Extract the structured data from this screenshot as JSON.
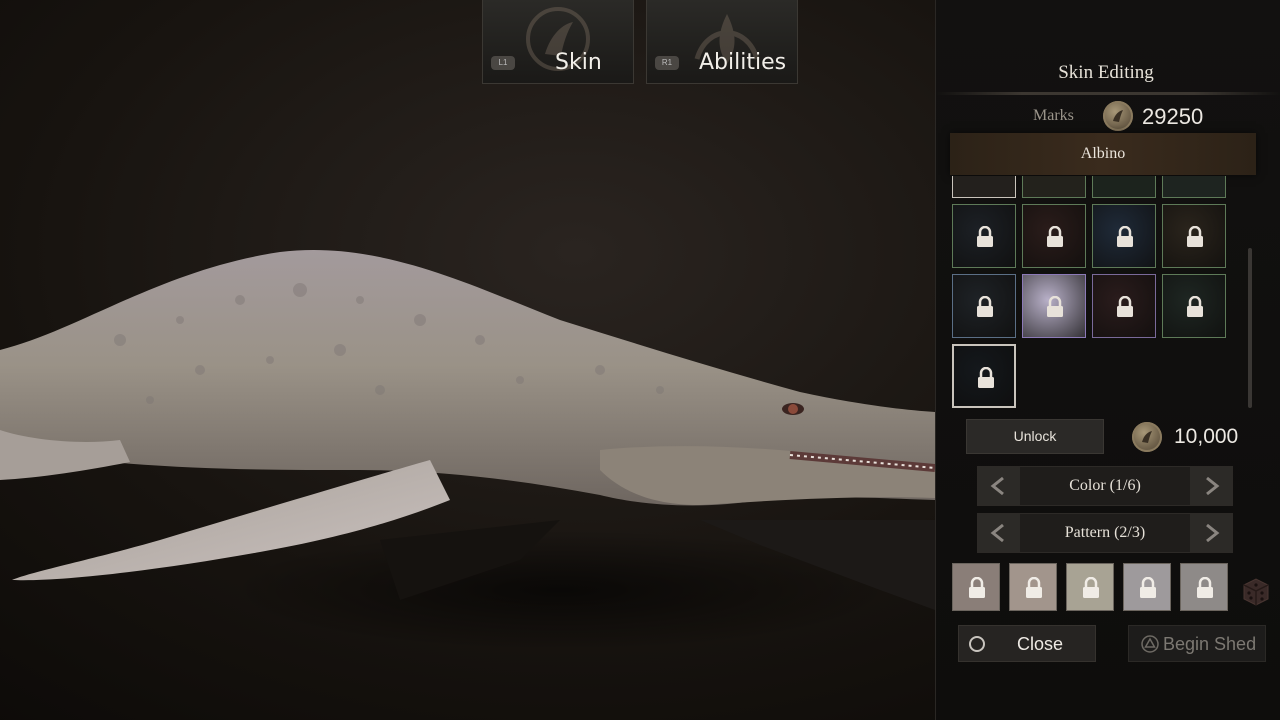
{
  "tabs": {
    "skin": {
      "label": "Skin",
      "button_hint": "L1"
    },
    "abilities": {
      "label": "Abilities",
      "button_hint": "R1"
    }
  },
  "panel": {
    "title": "Skin Editing",
    "marks_label": "Marks",
    "marks_value": "29250",
    "selected_skin": "Albino",
    "skin_tiles": [
      {
        "state": "locked",
        "border": "#5e7a58",
        "fill": "#1c2025"
      },
      {
        "state": "locked",
        "border": "#5e7a58",
        "fill": "#2a1c1a"
      },
      {
        "state": "locked",
        "border": "#5e7a58",
        "fill": "#1f2a38"
      },
      {
        "state": "locked",
        "border": "#5e7a58",
        "fill": "#2a241c"
      },
      {
        "state": "locked",
        "border": "#5b6f86",
        "fill": "#1e2226"
      },
      {
        "state": "selected-locked",
        "border": "#8c7ab8",
        "fill": "#b8b0c8"
      },
      {
        "state": "locked",
        "border": "#7a6a9a",
        "fill": "#2a1c1c"
      },
      {
        "state": "locked",
        "border": "#5e7a58",
        "fill": "#1e2622"
      },
      {
        "state": "locked",
        "border": "#c9c4bc",
        "fill": "#14181c"
      }
    ],
    "unlock_label": "Unlock",
    "unlock_cost": "10,000",
    "color_selector": "Color (1/6)",
    "pattern_selector": "Pattern (2/3)",
    "color_swatches": [
      {
        "color": "#8a7e78",
        "state": "locked"
      },
      {
        "color": "#a2958c",
        "state": "locked"
      },
      {
        "color": "#a8a394",
        "state": "locked"
      },
      {
        "color": "#9e9a9c",
        "state": "locked"
      },
      {
        "color": "#8e8a88",
        "state": "locked"
      }
    ],
    "close_label": "Close",
    "begin_shed_label": "Begin Shed"
  },
  "colors": {
    "accent_gold": "#8a7a5e",
    "panel_bg": "#121110",
    "banner": "#3a2b1d"
  }
}
